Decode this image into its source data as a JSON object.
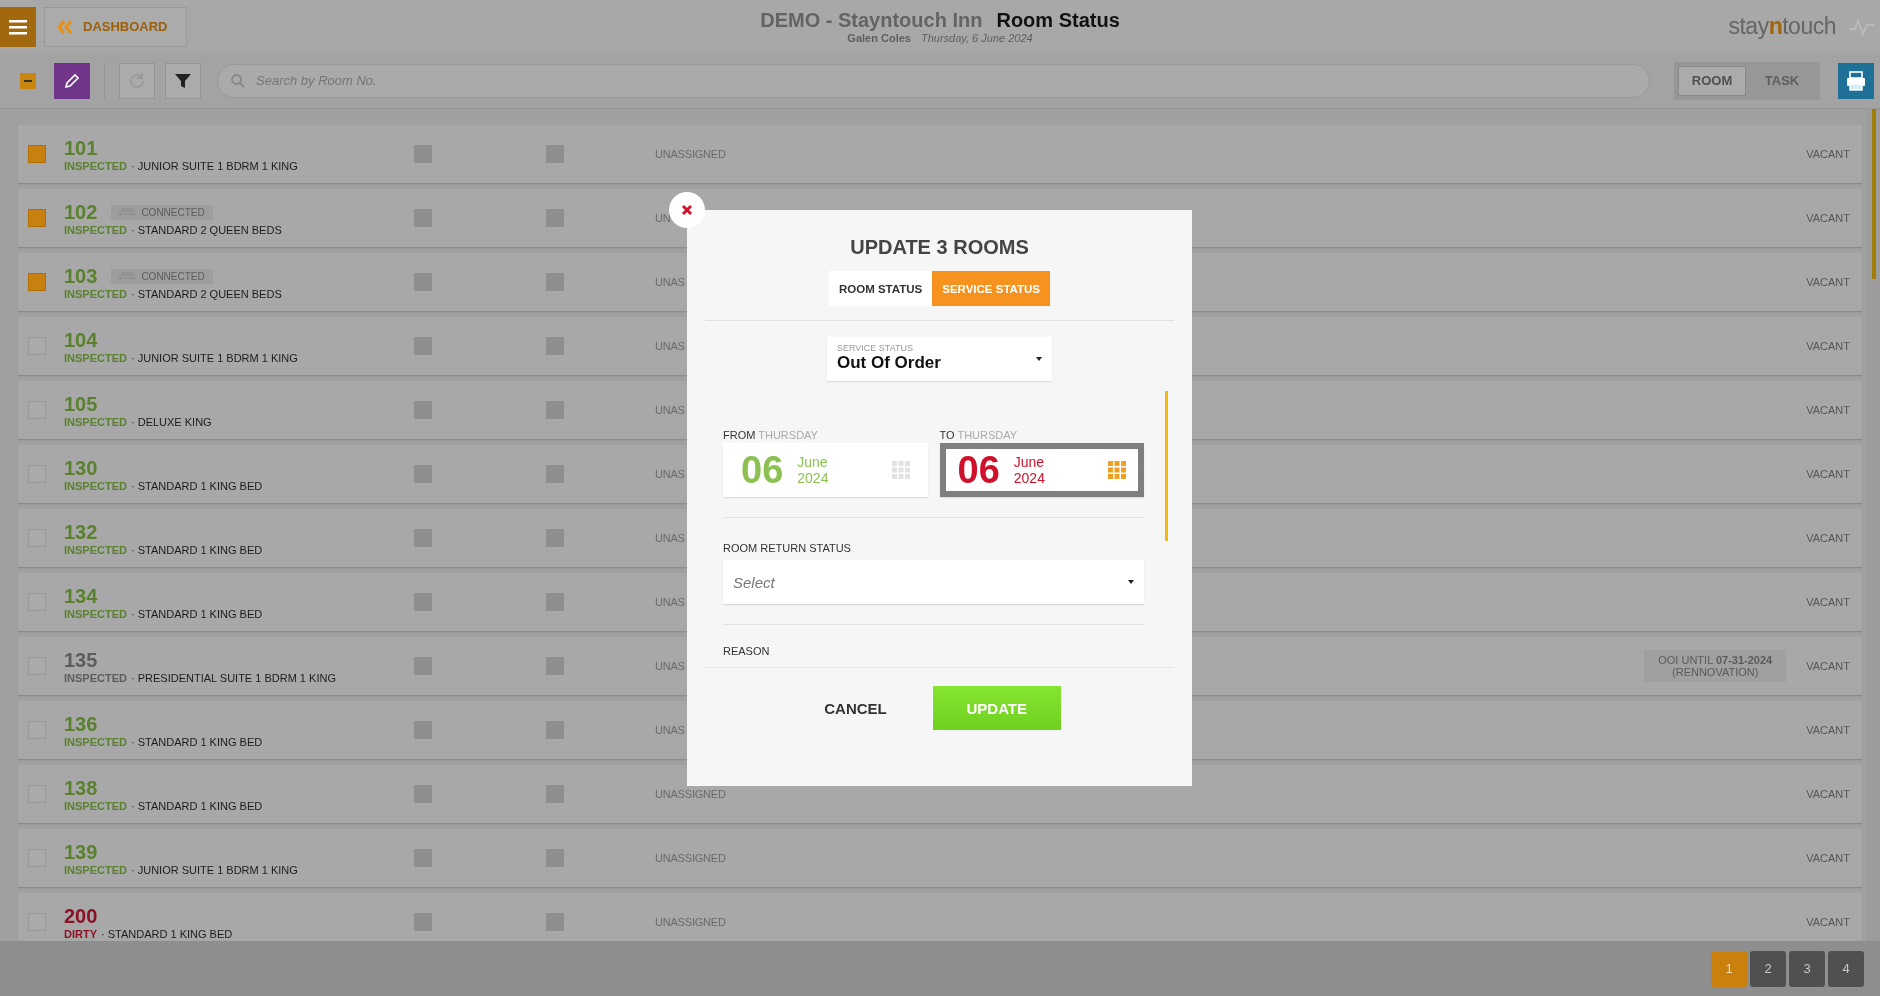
{
  "header": {
    "back_button": "DASHBOARD",
    "title_prefix": "DEMO - Stayntouch Inn",
    "title": "Room Status",
    "user": "Galen Coles",
    "date": "Thursday, 6 June 2024",
    "logo": "stay**n**touch"
  },
  "toolbar": {
    "select_all": {
      "partial": true
    },
    "search": {
      "placeholder": "Search by Room No."
    },
    "view_toggle": [
      {
        "label": "ROOM",
        "selected": true
      },
      {
        "label": "TASK",
        "selected": false
      }
    ]
  },
  "rooms": [
    {
      "number": "101",
      "status": "INSPECTED",
      "color": "#5a812d",
      "type": "· JUNIOR SUITE 1 BDRM 1 KING",
      "selected": true,
      "assignee": "UNASSIGNED",
      "occupancy": "VACANT"
    },
    {
      "number": "102",
      "badge": "CONNECTED",
      "status": "INSPECTED",
      "color": "#5a812d",
      "type": "· STANDARD 2 QUEEN BEDS",
      "selected": true,
      "assignee": "UN",
      "occupancy": "VACANT"
    },
    {
      "number": "103",
      "badge": "CONNECTED",
      "status": "INSPECTED",
      "color": "#5a812d",
      "type": "· STANDARD 2 QUEEN BEDS",
      "selected": true,
      "assignee": "UNAS",
      "occupancy": "VACANT"
    },
    {
      "number": "104",
      "status": "INSPECTED",
      "color": "#5a812d",
      "type": "· JUNIOR SUITE 1 BDRM 1 KING",
      "selected": false,
      "assignee": "UNAS",
      "occupancy": "VACANT"
    },
    {
      "number": "105",
      "status": "INSPECTED",
      "color": "#5a812d",
      "type": "· DELUXE KING",
      "selected": false,
      "assignee": "UNAS",
      "occupancy": "VACANT"
    },
    {
      "number": "130",
      "status": "INSPECTED",
      "color": "#5a812d",
      "type": "· STANDARD 1 KING BED",
      "selected": false,
      "assignee": "UNAS",
      "occupancy": "VACANT"
    },
    {
      "number": "132",
      "status": "INSPECTED",
      "color": "#5a812d",
      "type": "· STANDARD 1 KING BED",
      "selected": false,
      "assignee": "UNAS",
      "occupancy": "VACANT"
    },
    {
      "number": "134",
      "status": "INSPECTED",
      "color": "#5a812d",
      "type": "· STANDARD 1 KING BED",
      "selected": false,
      "assignee": "UNAS",
      "occupancy": "VACANT"
    },
    {
      "number": "135",
      "status": "INSPECTED",
      "color": "#5c5c5c",
      "type": "· PRESIDENTIAL SUITE 1 BDRM 1 KING",
      "selected": false,
      "assignee": "UNAS",
      "note": "OOI UNTIL **07-31-2024**",
      "note_reason": "(RENNOVATION)",
      "occupancy": "VACANT"
    },
    {
      "number": "136",
      "status": "INSPECTED",
      "color": "#5a812d",
      "type": "· STANDARD 1 KING BED",
      "selected": false,
      "assignee": "UNAS",
      "occupancy": "VACANT"
    },
    {
      "number": "138",
      "status": "INSPECTED",
      "color": "#5a812d",
      "type": "· STANDARD 1 KING BED",
      "selected": false,
      "assignee": "UNASSIGNED",
      "occupancy": "VACANT"
    },
    {
      "number": "139",
      "status": "INSPECTED",
      "color": "#5a812d",
      "type": "· JUNIOR SUITE 1 BDRM 1 KING",
      "selected": false,
      "assignee": "UNASSIGNED",
      "occupancy": "VACANT"
    },
    {
      "number": "200",
      "status": "DIRTY",
      "color": "#8b1224",
      "type": "· STANDARD 1 KING BED",
      "selected": false,
      "assignee": "UNASSIGNED",
      "occupancy": "VACANT"
    }
  ],
  "pagination": [
    {
      "label": "1",
      "selected": true
    },
    {
      "label": "2",
      "selected": false
    },
    {
      "label": "3",
      "selected": false
    },
    {
      "label": "4",
      "selected": false
    }
  ],
  "modal": {
    "title": "UPDATE 3 ROOMS",
    "tabs": [
      {
        "label": "ROOM STATUS",
        "selected": false
      },
      {
        "label": "SERVICE STATUS",
        "selected": true
      }
    ],
    "service_status": {
      "label": "SERVICE STATUS",
      "value": "Out Of Order"
    },
    "dates": [
      {
        "label": "FROM",
        "weekday": "THURSDAY",
        "day": "06",
        "month": "June",
        "year": "2024",
        "kind": "from",
        "focused": false
      },
      {
        "label": "TO",
        "weekday": "THURSDAY",
        "day": "06",
        "month": "June",
        "year": "2024",
        "kind": "to",
        "focused": true
      }
    ],
    "return_status": {
      "label": "ROOM RETURN STATUS",
      "placeholder": "Select"
    },
    "reason_label": "REASON",
    "cancel": "CANCEL",
    "update": "UPDATE"
  }
}
